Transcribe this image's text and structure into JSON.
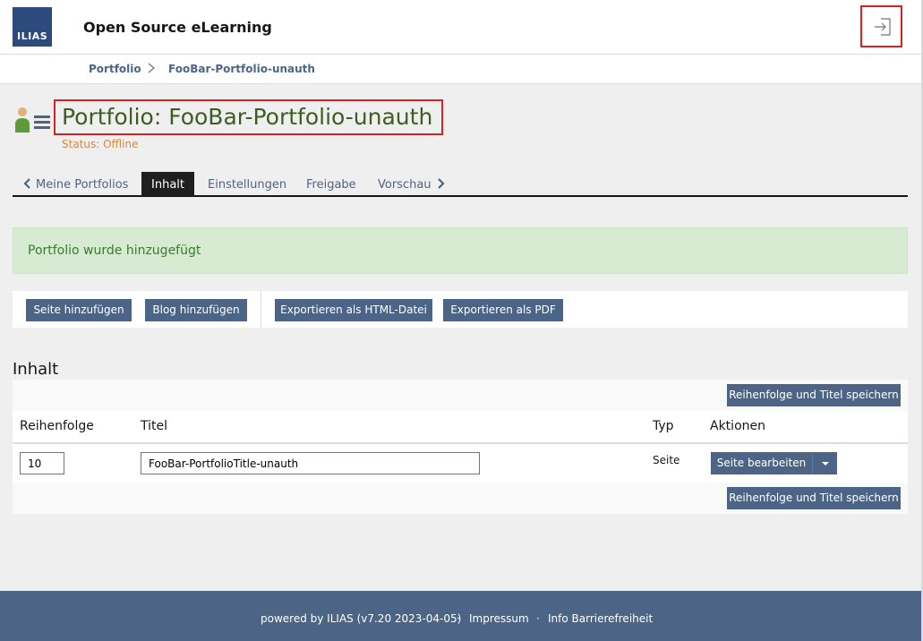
{
  "header": {
    "logo_text": "ILIAS",
    "site_title": "Open Source eLearning",
    "login_icon": "sign-in-icon"
  },
  "breadcrumb": {
    "items": [
      "Portfolio",
      "FooBar-Portfolio-unauth"
    ],
    "separator": ">"
  },
  "page": {
    "title": "Portfolio: FooBar-Portfolio-unauth",
    "status": "Status: Offline",
    "icon": "portfolio-icon"
  },
  "tabs": {
    "back_label": "Meine Portfolios",
    "items": [
      "Inhalt",
      "Einstellungen",
      "Freigabe",
      "Vorschau"
    ],
    "active": "Inhalt"
  },
  "alert": {
    "message": "Portfolio wurde hinzugefügt"
  },
  "toolbar": {
    "add_page": "Seite hinzufügen",
    "add_blog": "Blog hinzufügen",
    "export_html": "Exportieren als HTML-Datei",
    "export_pdf": "Exportieren als PDF"
  },
  "content": {
    "heading": "Inhalt",
    "save_button": "Reihenfolge und Titel speichern",
    "columns": [
      "Reihenfolge",
      "Titel",
      "Typ",
      "Aktionen"
    ],
    "rows": [
      {
        "order": "10",
        "title": "FooBar-PortfolioTitle-unauth",
        "type": "Seite",
        "action": "Seite bearbeiten"
      }
    ]
  },
  "footer": {
    "powered": "powered by ILIAS (v7.20 2023-04-05)",
    "dot": "·",
    "impressum": "Impressum",
    "accessibility": "Info Barrierefreiheit"
  },
  "colors": {
    "primary": "#4c6586",
    "brand_logo": "#2c4a7b",
    "title_green": "#3e5d22",
    "status_orange": "#d38a4c",
    "success_bg": "#d6ebd1",
    "success_text": "#3a7b2e",
    "highlight_red": "#d62222"
  }
}
